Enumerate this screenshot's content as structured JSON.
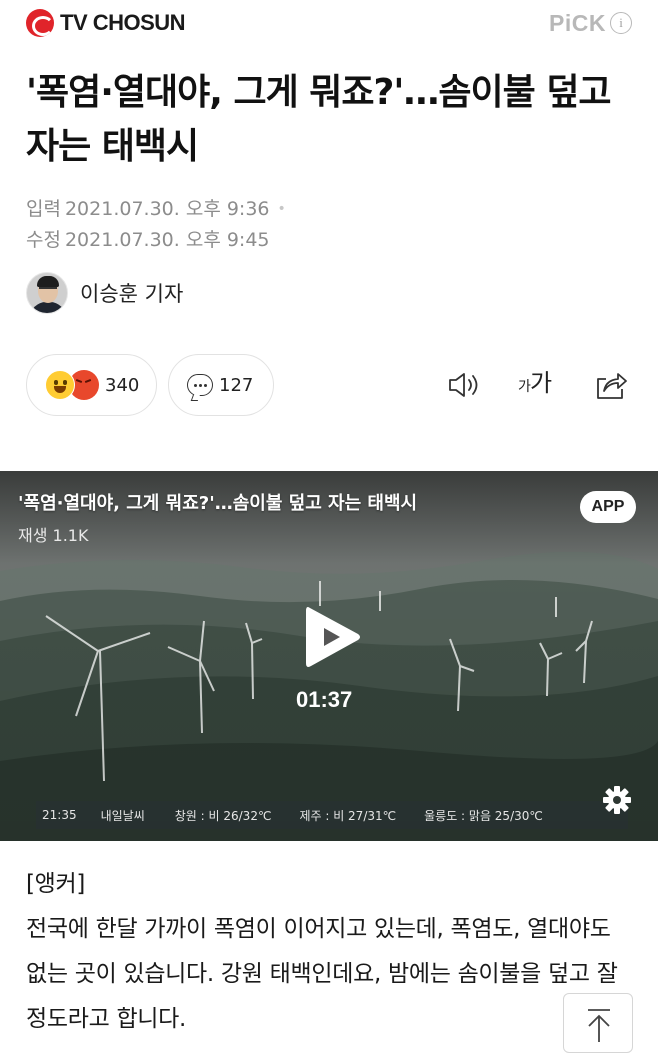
{
  "header": {
    "brand": "TV CHOSUN",
    "pick_label": "PiCK",
    "info_glyph": "i"
  },
  "article": {
    "title": "'폭염·열대야, 그게 뭐죠?'…솜이불 덮고 자는 태백시",
    "published_label": "입력",
    "published": "2021.07.30. 오후 9:36",
    "modified_label": "수정",
    "modified": "2021.07.30. 오후 9:45",
    "reporter": "이승훈 기자"
  },
  "actions": {
    "reaction_count": "340",
    "comment_count": "127",
    "font_small": "가",
    "font_big": "가"
  },
  "video": {
    "title": "'폭염·열대야, 그게 뭐죠?'…솜이불 덮고 자는 태백시",
    "views": "재생 1.1K",
    "app_badge": "APP",
    "duration": "01:37",
    "ticker": {
      "time": "21:35",
      "label": "내일날씨",
      "items": [
        "창원 : 비 26/32℃",
        "제주 : 비 27/31℃",
        "울릉도 : 맑음 25/30℃"
      ]
    }
  },
  "body": {
    "anchor_tag": "[앵커]",
    "paragraph": "전국에 한달 가까이 폭염이 이어지고 있는데, 폭염도, 열대야도 없는 곳이 있습니다. 강원 태백인데요, 밤에는 솜이불을 덮고 잘 정도라고 합니다."
  },
  "icons": {
    "brand_logo": "tv-chosun-logo",
    "info": "info-icon",
    "reaction_smile": "smile-emoji-icon",
    "reaction_angry": "angry-emoji-icon",
    "comment": "comment-bubble-icon",
    "speaker": "speaker-icon",
    "font_size": "font-size-icon",
    "share": "share-icon",
    "play": "play-icon",
    "settings": "gear-icon",
    "scroll_top": "arrow-up-icon"
  },
  "colors": {
    "brand_red": "#e0242a",
    "pick_gray": "#b8b8b8",
    "meta_gray": "#8c8c8c"
  }
}
